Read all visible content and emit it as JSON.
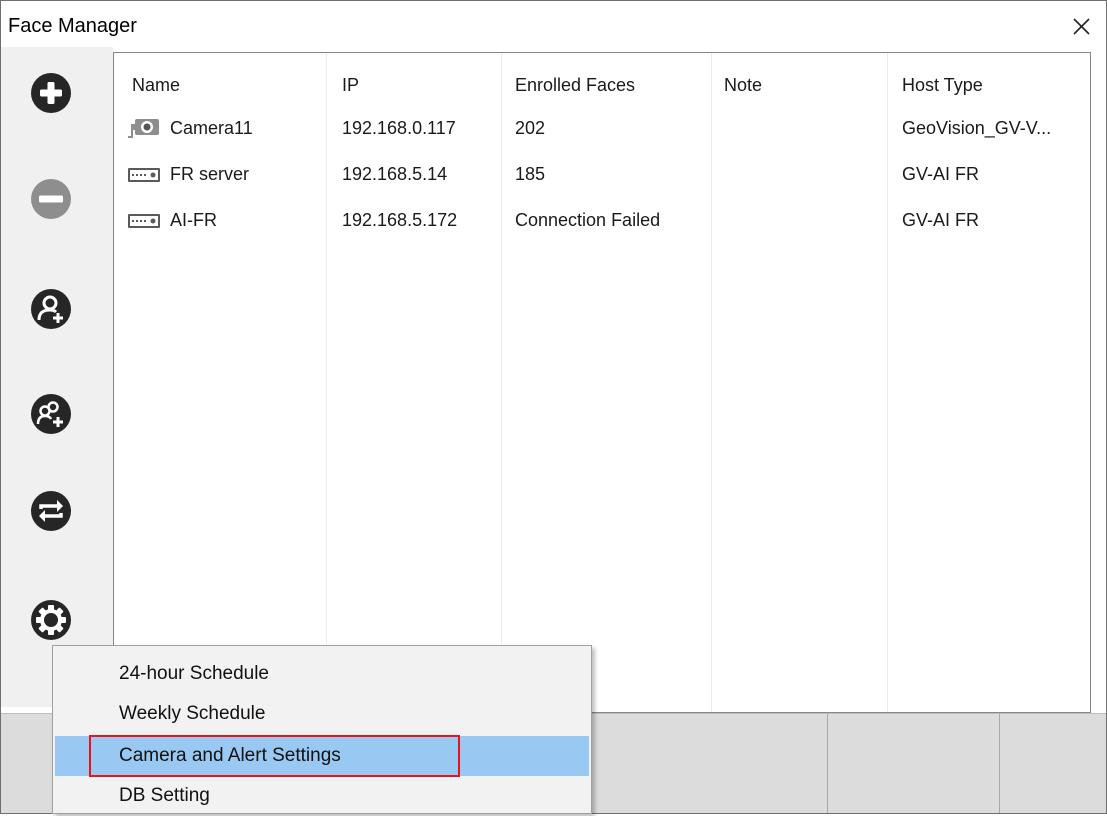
{
  "window": {
    "title": "Face Manager"
  },
  "sidebar": {
    "buttons": [
      {
        "icon": "add-icon"
      },
      {
        "icon": "remove-icon"
      },
      {
        "icon": "add-person-icon"
      },
      {
        "icon": "add-group-icon"
      },
      {
        "icon": "sync-icon"
      },
      {
        "icon": "gear-icon"
      }
    ]
  },
  "table": {
    "columns": [
      "Name",
      "IP",
      "Enrolled Faces",
      "Note",
      "Host Type"
    ],
    "rows": [
      {
        "icon": "camera-icon",
        "name": "Camera11",
        "ip": "192.168.0.117",
        "enrolled": "202",
        "note": "",
        "host_type": "GeoVision_GV-V..."
      },
      {
        "icon": "server-icon",
        "name": "FR server",
        "ip": "192.168.5.14",
        "enrolled": "185",
        "note": "",
        "host_type": "GV-AI FR"
      },
      {
        "icon": "server-icon",
        "name": "AI-FR",
        "ip": "192.168.5.172",
        "enrolled": "Connection Failed",
        "note": "",
        "host_type": "GV-AI FR"
      }
    ]
  },
  "context_menu": {
    "items": [
      "24-hour Schedule",
      "Weekly Schedule",
      "Camera and Alert Settings",
      "DB Setting"
    ],
    "highlighted": "Camera and Alert Settings"
  },
  "colors": {
    "icon_dark": "#262626",
    "icon_disabled": "#8e8e8e",
    "highlight": "#99c9f3",
    "callout": "#e8141a"
  }
}
